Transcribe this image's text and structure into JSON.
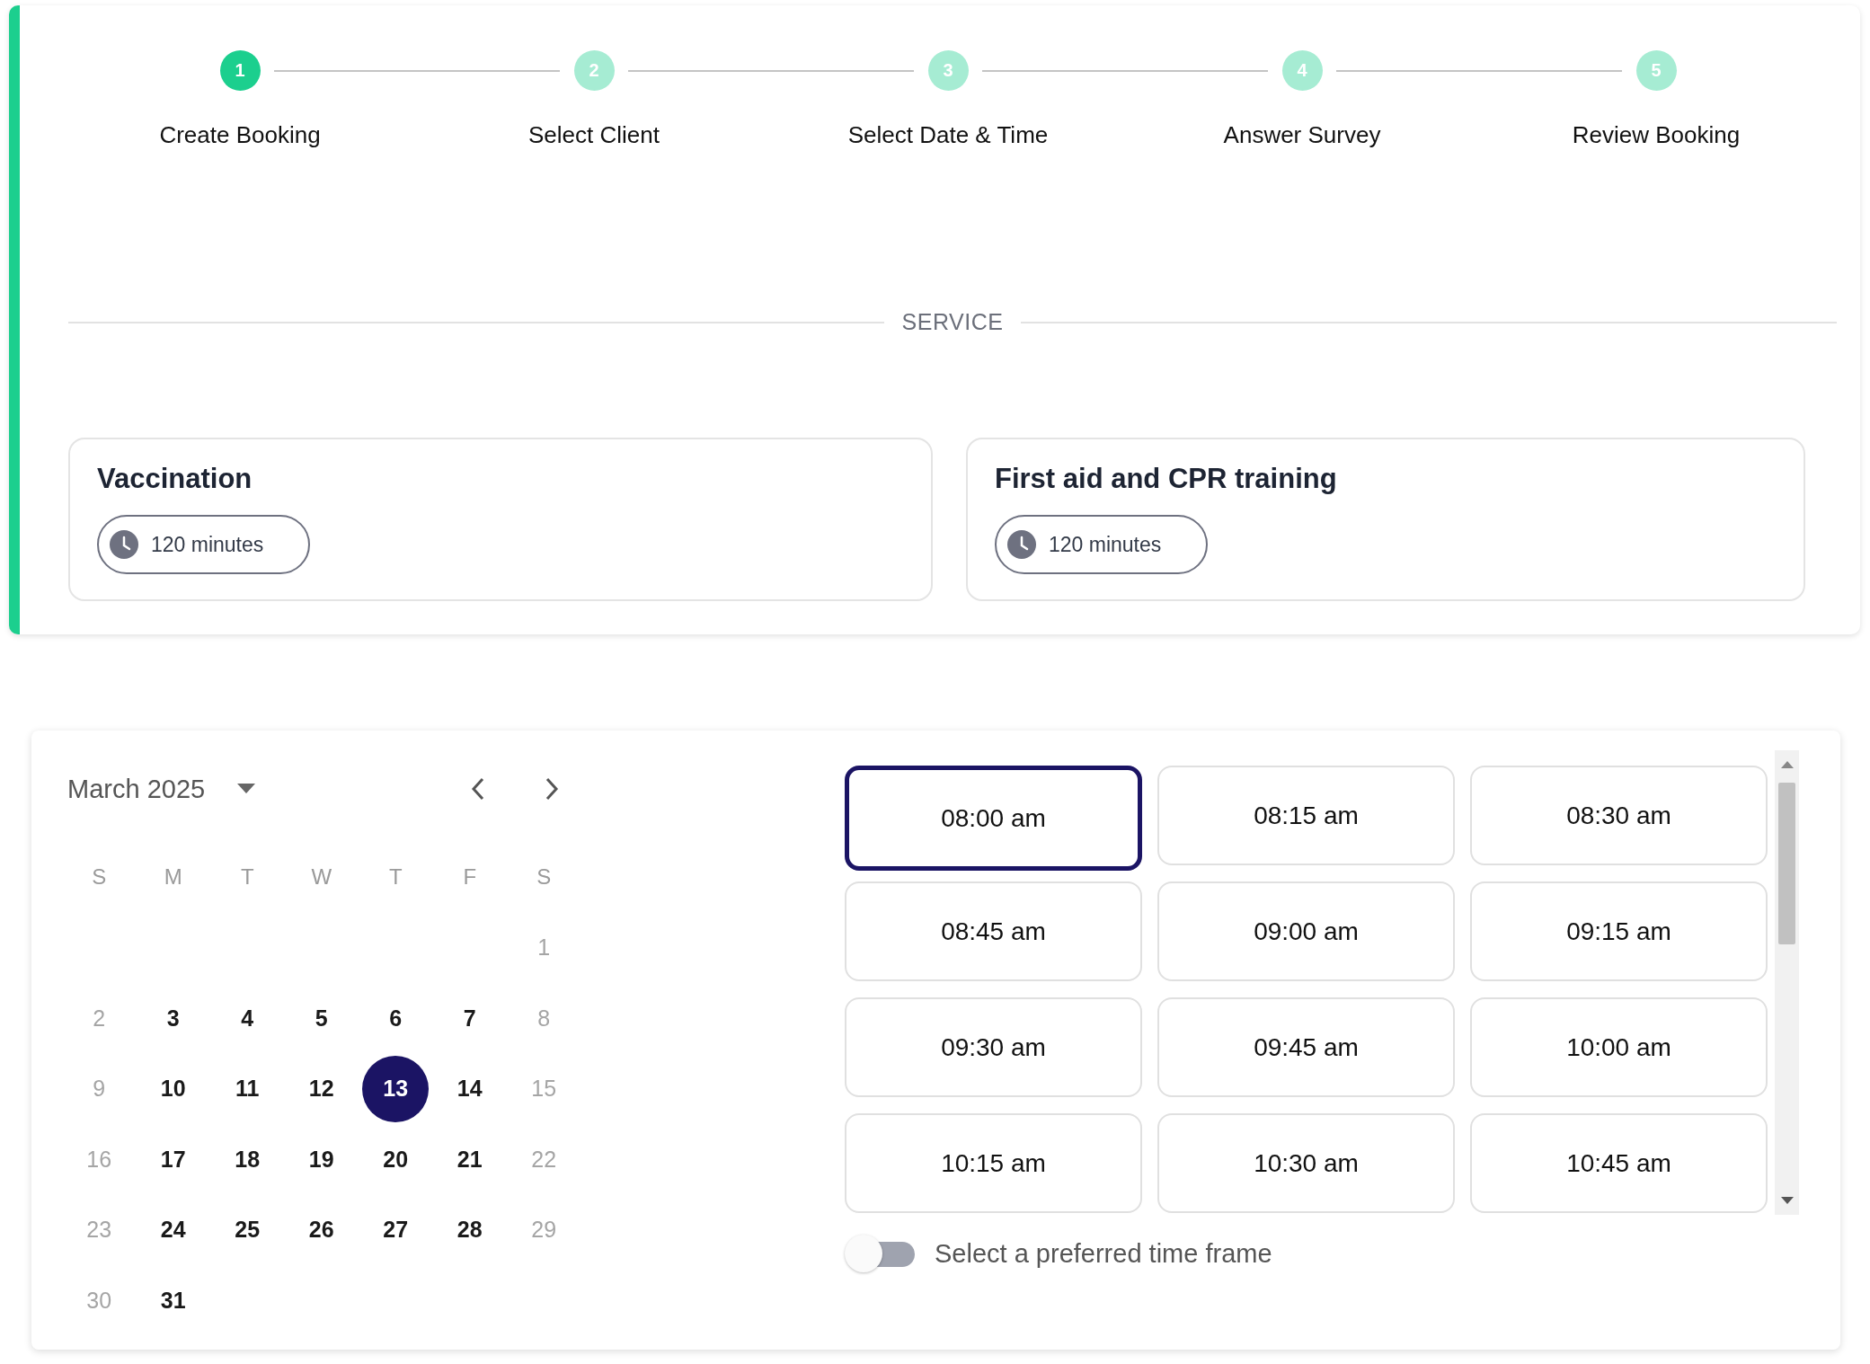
{
  "stepper": [
    {
      "number": "1",
      "label": "Create Booking",
      "current": true
    },
    {
      "number": "2",
      "label": "Select Client",
      "current": false
    },
    {
      "number": "3",
      "label": "Select Date & Time",
      "current": false
    },
    {
      "number": "4",
      "label": "Answer Survey",
      "current": false
    },
    {
      "number": "5",
      "label": "Review Booking",
      "current": false
    }
  ],
  "section_title": "SERVICE",
  "services": [
    {
      "title": "Vaccination",
      "duration": "120 minutes"
    },
    {
      "title": "First aid and CPR training",
      "duration": "120 minutes"
    }
  ],
  "calendar": {
    "month": "March 2025",
    "weekdays": [
      "S",
      "M",
      "T",
      "W",
      "T",
      "F",
      "S"
    ],
    "weeks": [
      [
        {
          "label": "1",
          "disabled": true,
          "selected": false
        }
      ],
      [
        {
          "label": "2",
          "disabled": true,
          "selected": false
        },
        {
          "label": "3",
          "disabled": false,
          "selected": false
        },
        {
          "label": "4",
          "disabled": false,
          "selected": false
        },
        {
          "label": "5",
          "disabled": false,
          "selected": false
        },
        {
          "label": "6",
          "disabled": false,
          "selected": false
        },
        {
          "label": "7",
          "disabled": false,
          "selected": false
        },
        {
          "label": "8",
          "disabled": true,
          "selected": false
        }
      ],
      [
        {
          "label": "9",
          "disabled": true,
          "selected": false
        },
        {
          "label": "10",
          "disabled": false,
          "selected": false
        },
        {
          "label": "11",
          "disabled": false,
          "selected": false
        },
        {
          "label": "12",
          "disabled": false,
          "selected": false
        },
        {
          "label": "13",
          "disabled": false,
          "selected": true
        },
        {
          "label": "14",
          "disabled": false,
          "selected": false
        },
        {
          "label": "15",
          "disabled": true,
          "selected": false
        }
      ],
      [
        {
          "label": "16",
          "disabled": true,
          "selected": false
        },
        {
          "label": "17",
          "disabled": false,
          "selected": false
        },
        {
          "label": "18",
          "disabled": false,
          "selected": false
        },
        {
          "label": "19",
          "disabled": false,
          "selected": false
        },
        {
          "label": "20",
          "disabled": false,
          "selected": false
        },
        {
          "label": "21",
          "disabled": false,
          "selected": false
        },
        {
          "label": "22",
          "disabled": true,
          "selected": false
        }
      ],
      [
        {
          "label": "23",
          "disabled": true,
          "selected": false
        },
        {
          "label": "24",
          "disabled": false,
          "selected": false
        },
        {
          "label": "25",
          "disabled": false,
          "selected": false
        },
        {
          "label": "26",
          "disabled": false,
          "selected": false
        },
        {
          "label": "27",
          "disabled": false,
          "selected": false
        },
        {
          "label": "28",
          "disabled": false,
          "selected": false
        },
        {
          "label": "29",
          "disabled": true,
          "selected": false
        }
      ],
      [
        {
          "label": "30",
          "disabled": true,
          "selected": false
        },
        {
          "label": "31",
          "disabled": false,
          "selected": false
        }
      ]
    ]
  },
  "time_slots": [
    {
      "label": "08:00 am",
      "selected": true
    },
    {
      "label": "08:15 am",
      "selected": false
    },
    {
      "label": "08:30 am",
      "selected": false
    },
    {
      "label": "08:45 am",
      "selected": false
    },
    {
      "label": "09:00 am",
      "selected": false
    },
    {
      "label": "09:15 am",
      "selected": false
    },
    {
      "label": "09:30 am",
      "selected": false
    },
    {
      "label": "09:45 am",
      "selected": false
    },
    {
      "label": "10:00 am",
      "selected": false
    },
    {
      "label": "10:15 am",
      "selected": false
    },
    {
      "label": "10:30 am",
      "selected": false
    },
    {
      "label": "10:45 am",
      "selected": false
    }
  ],
  "preferred_time_frame": {
    "label": "Select a preferred time frame",
    "on": false
  }
}
